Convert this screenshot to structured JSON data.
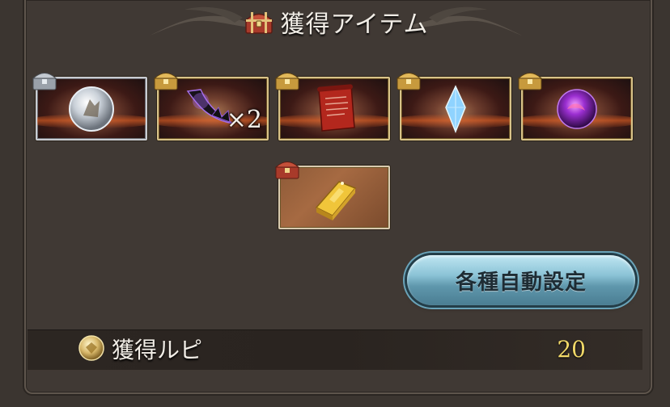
{
  "header": {
    "title": "獲得アイテム",
    "icon": "treasure-chest-icon"
  },
  "items": [
    {
      "name": "silver-sphere",
      "badge": "silver-chest-icon",
      "qty": ""
    },
    {
      "name": "dark-fang",
      "badge": "gold-chest-icon",
      "qty": "×2"
    },
    {
      "name": "scroll",
      "badge": "gold-chest-icon",
      "qty": ""
    },
    {
      "name": "crystal",
      "badge": "gold-chest-icon",
      "qty": ""
    },
    {
      "name": "dark-orb",
      "badge": "gold-chest-icon",
      "qty": ""
    },
    {
      "name": "gold-bar",
      "badge": "red-chest-icon",
      "qty": ""
    }
  ],
  "buttons": {
    "auto_settings": "各種自動設定"
  },
  "rupie": {
    "label": "獲得ルピ",
    "value": "20"
  },
  "colors": {
    "panel": "#403934",
    "gold_frame": "#d8c389",
    "button": "#8bc3d6",
    "rupie_value": "#f1d968"
  }
}
